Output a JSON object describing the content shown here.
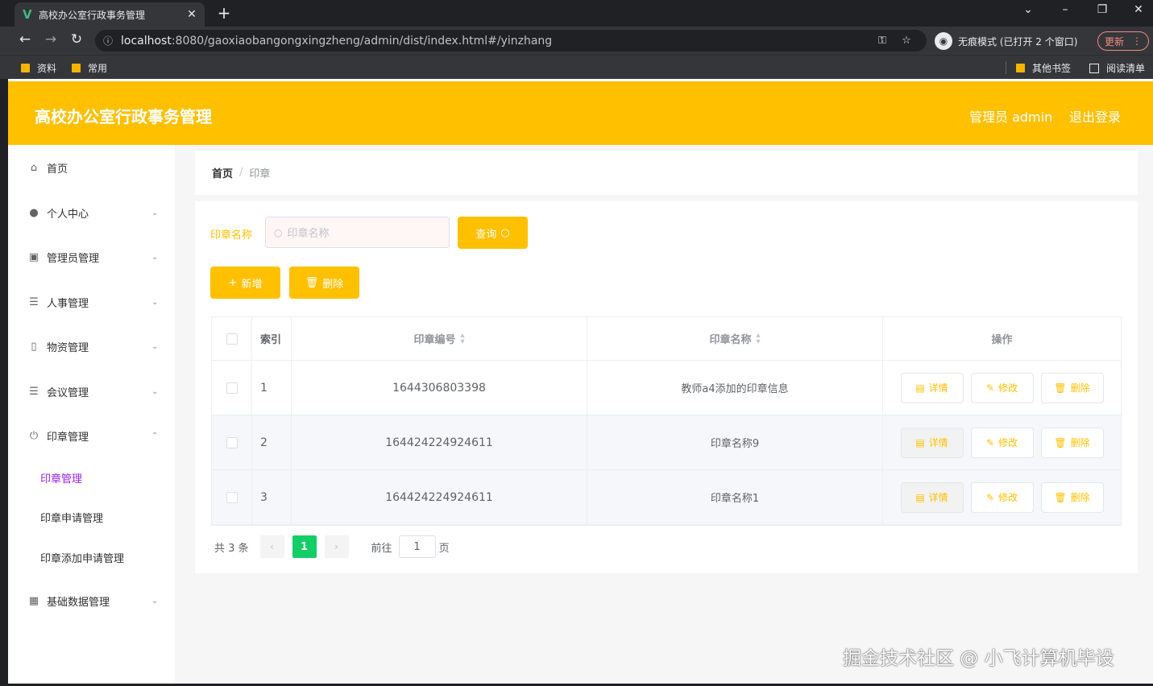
{
  "browser": {
    "tab_title": "高校办公室行政事务管理",
    "tab_favicon": "V",
    "url_host": "localhost",
    "url_rest": ":8080/gaoxiaobangongxingzheng/admin/dist/index.html#/yinzhang",
    "incognito_label": "无痕模式 (已打开 2 个窗口)",
    "update_label": "更新",
    "bookmarks": [
      "资料",
      "常用"
    ],
    "other_bookmarks": "其他书签",
    "reading_list": "阅读清单"
  },
  "header": {
    "title": "高校办公室行政事务管理",
    "admin_label": "管理员 admin",
    "logout": "退出登录",
    "color": "#ffc000"
  },
  "sidebar": {
    "items": [
      {
        "label": "首页",
        "icon": "home-icon"
      },
      {
        "label": "个人中心",
        "icon": "user-icon"
      },
      {
        "label": "管理员管理",
        "icon": "chart-icon"
      },
      {
        "label": "人事管理",
        "icon": "list-icon"
      },
      {
        "label": "物资管理",
        "icon": "phone-icon"
      },
      {
        "label": "会议管理",
        "icon": "list-icon"
      },
      {
        "label": "印章管理",
        "icon": "power-icon"
      },
      {
        "label": "基础数据管理",
        "icon": "grid-icon"
      }
    ],
    "sub_items": [
      {
        "label": "印章管理",
        "active": true
      },
      {
        "label": "印章申请管理",
        "active": false
      },
      {
        "label": "印章添加申请管理",
        "active": false
      }
    ]
  },
  "breadcrumb": {
    "home": "首页",
    "separator": "/",
    "current": "印章"
  },
  "search": {
    "label": "印章名称",
    "placeholder": "印章名称",
    "button": "查询"
  },
  "actions": {
    "add": "新增",
    "delete": "删除"
  },
  "table": {
    "headers": [
      "索引",
      "印章编号",
      "印章名称",
      "操作"
    ],
    "rows": [
      {
        "index": "1",
        "code": "1644306803398",
        "name": "教师a4添加的印章信息"
      },
      {
        "index": "2",
        "code": "164424224924611",
        "name": "印章名称9"
      },
      {
        "index": "3",
        "code": "164424224924611",
        "name": "印章名称1"
      }
    ],
    "op_detail": "详情",
    "op_edit": "修改",
    "op_delete": "删除"
  },
  "pagination": {
    "total_text": "共 3 条",
    "current_page": "1",
    "goto_label": "前往",
    "goto_value": "1",
    "page_suffix": "页"
  },
  "watermark": "掘金技术社区 @ 小飞计算机毕设"
}
